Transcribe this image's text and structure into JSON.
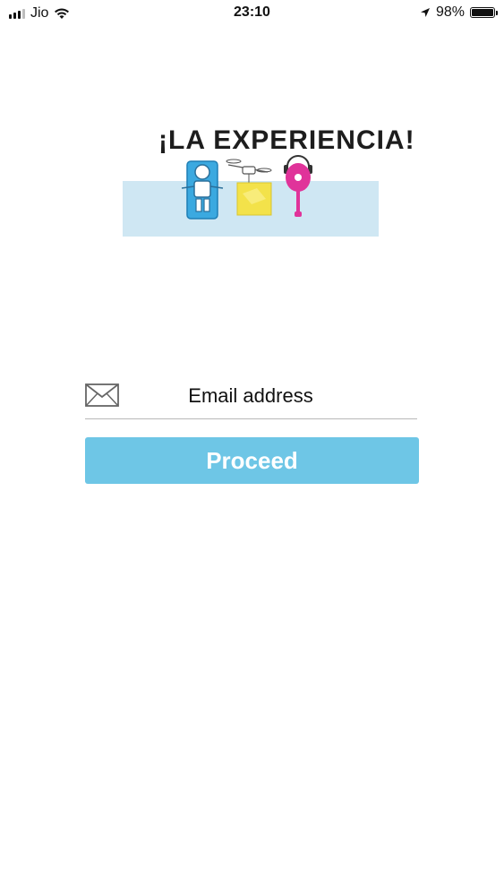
{
  "status_bar": {
    "carrier": "Jio",
    "time": "23:10",
    "battery_percent_label": "98%",
    "battery_level": 0.98,
    "icons": [
      "signal-icon",
      "wifi-icon",
      "location-arrow-icon",
      "battery-icon"
    ]
  },
  "logo": {
    "text": "¡LA EXPERIENCIA!",
    "band_color": "#cfe7f3"
  },
  "form": {
    "email_placeholder": "Email address",
    "email_value": "",
    "mail_icon": "envelope-icon",
    "proceed_label": "Proceed",
    "button_color": "#6ec6e6"
  }
}
